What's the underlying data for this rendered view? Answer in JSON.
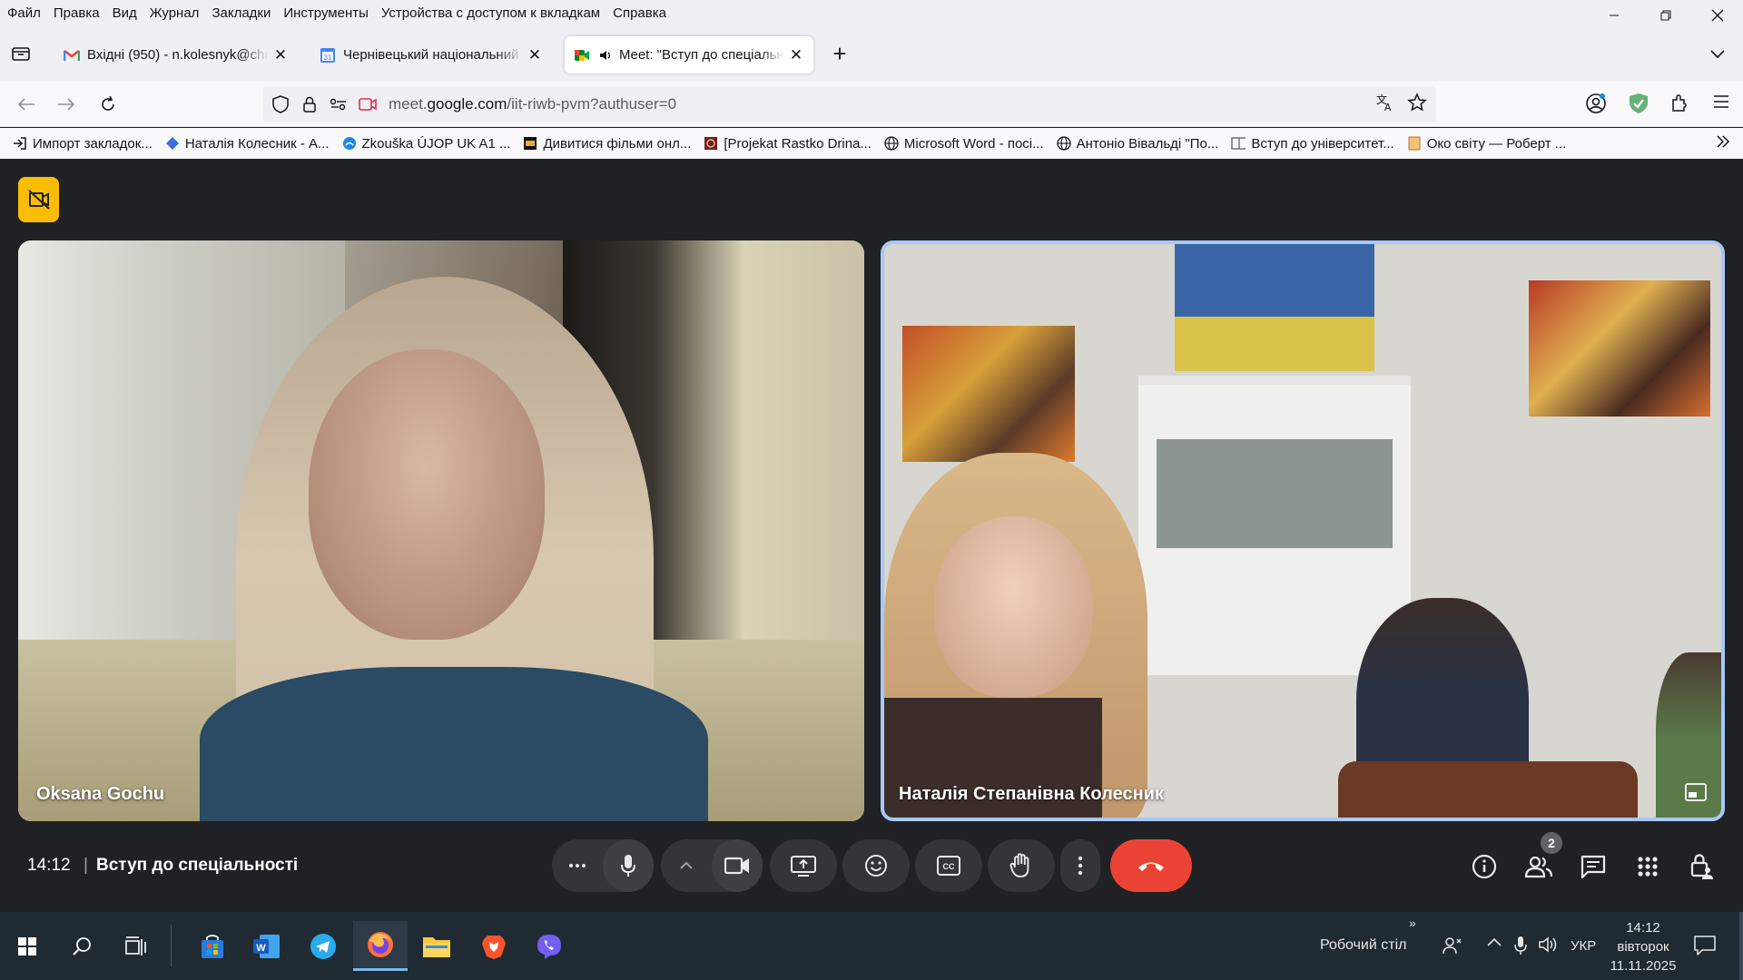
{
  "menubar": {
    "items": [
      "Файл",
      "Правка",
      "Вид",
      "Журнал",
      "Закладки",
      "Инструменты",
      "Устройства с доступом к вкладкам",
      "Справка"
    ]
  },
  "tabs": [
    {
      "label": "Вхідні (950) - n.kolesnyk@chnu.",
      "favicon": "gmail-icon",
      "active": false
    },
    {
      "label": "Чернівецький національний у",
      "favicon": "calendar-icon",
      "active": false
    },
    {
      "label": "Meet: \"Вступ до спеціальн",
      "favicon": "meet-icon",
      "active": true
    }
  ],
  "navbar": {
    "url_prefix": "meet.",
    "url_domain": "google.com",
    "url_path": "/iit-riwb-pvm?authuser=0"
  },
  "bookmarks": [
    {
      "label": "Импорт закладок...",
      "icon": "import-icon"
    },
    {
      "label": "Наталія Колесник - A...",
      "icon": "diamond-icon"
    },
    {
      "label": "Zkouška ÚJOP UK A1 ...",
      "icon": "cloud-icon"
    },
    {
      "label": "Дивитися фільми онл...",
      "icon": "film-icon"
    },
    {
      "label": "[Projekat Rastko Drina...",
      "icon": "rastko-icon"
    },
    {
      "label": "Microsoft Word - посі...",
      "icon": "globe-icon"
    },
    {
      "label": "Антоніо Вівальді \"По...",
      "icon": "globe-icon"
    },
    {
      "label": "Вступ до університет...",
      "icon": "book-icon"
    },
    {
      "label": "Око світу — Роберт ...",
      "icon": "page-icon"
    }
  ],
  "meet": {
    "participants": [
      {
        "name": "Oksana Gochu"
      },
      {
        "name": "Наталія Степанівна Колесник"
      }
    ],
    "time": "14:12",
    "separator": "|",
    "meeting_title": "Вступ до спеціальності",
    "people_count": "2"
  },
  "taskbar": {
    "desktop_label": "Робочий стіл",
    "language": "УКР",
    "clock_time": "14:12",
    "clock_day": "вівторок",
    "clock_date": "11.11.2025"
  },
  "colors": {
    "meet_bg": "#202124",
    "end_call": "#ea4335",
    "recording_badge": "#fbbc04",
    "active_speaker_border": "#a8c7fa",
    "taskbar_bg": "#1f2a33"
  }
}
